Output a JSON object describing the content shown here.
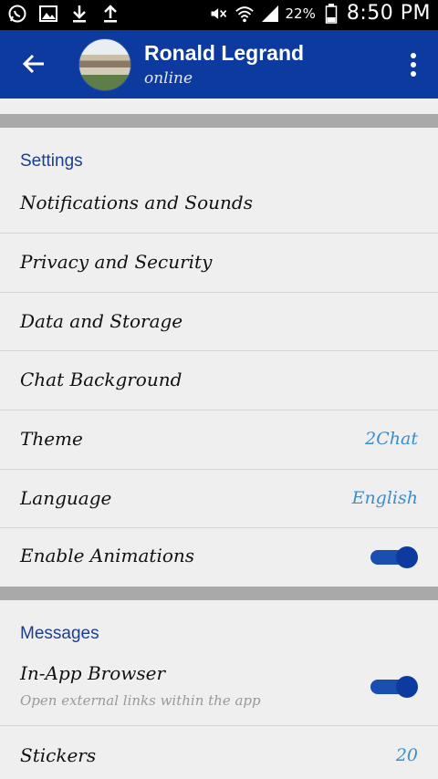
{
  "status_bar": {
    "battery_percent": "22%",
    "time": "8:50 PM",
    "icons": [
      "whatsapp-icon",
      "image-icon",
      "download-icon",
      "upload-icon",
      "mute-icon",
      "wifi-icon",
      "signal-icon",
      "battery-icon"
    ]
  },
  "header": {
    "title": "Ronald Legrand",
    "subtitle": "online",
    "colors": {
      "bar": "#0d3a9e"
    }
  },
  "settings": {
    "header": "Settings",
    "items": [
      {
        "label": "Notifications and Sounds"
      },
      {
        "label": "Privacy and Security"
      },
      {
        "label": "Data and Storage"
      },
      {
        "label": "Chat Background"
      },
      {
        "label": "Theme",
        "value": "2Chat"
      },
      {
        "label": "Language",
        "value": "English"
      },
      {
        "label": "Enable Animations",
        "toggle": true
      }
    ]
  },
  "messages": {
    "header": "Messages",
    "in_app_browser": {
      "label": "In-App Browser",
      "sub": "Open external links within the app",
      "toggle": true
    },
    "stickers": {
      "label": "Stickers",
      "value": "20"
    }
  }
}
